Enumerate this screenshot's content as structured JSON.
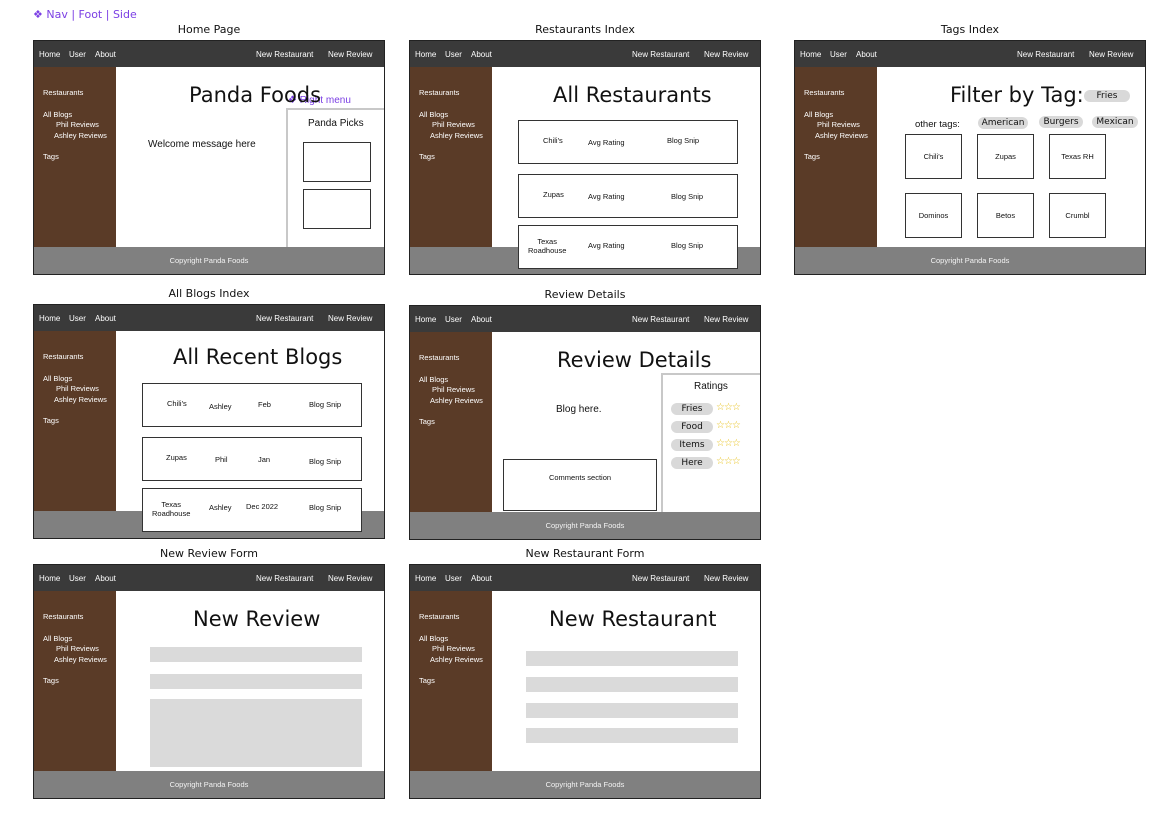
{
  "component_label": "❖ Nav | Foot | Side",
  "nav": {
    "home": "Home",
    "user": "User",
    "about": "About",
    "new_restaurant": "New Restaurant",
    "new_review": "New Review"
  },
  "side": {
    "restaurants": "Restaurants",
    "all_blogs": "All Blogs",
    "phil": "Phil Reviews",
    "ashley": "Ashley Reviews",
    "tags": "Tags"
  },
  "footer": "Copyright Panda Foods",
  "home": {
    "frame_title": "Home  Page",
    "heading": "Panda Foods",
    "welcome": "Welcome message here",
    "right_menu_label": "❖ Right menu",
    "picks": "Panda Picks"
  },
  "restaurants_index": {
    "frame_title": "Restaurants Index",
    "heading": "All Restaurants",
    "rows": [
      {
        "name": "Chili's",
        "rating": "Avg Rating",
        "snip": "Blog Snip"
      },
      {
        "name": "Zupas",
        "rating": "Avg Rating",
        "snip": "Blog Snip"
      },
      {
        "name": "Texas\nRoadhouse",
        "rating": "Avg Rating",
        "snip": "Blog Snip"
      }
    ]
  },
  "tags_index": {
    "frame_title": "Tags Index",
    "heading": "Filter by Tag:",
    "active_tag": "Fries",
    "other_label": "other tags:",
    "other_tags": [
      "American",
      "Burgers",
      "Mexican"
    ],
    "cards": [
      "Chili's",
      "Zupas",
      "Texas RH",
      "Dominos",
      "Betos",
      "Crumbl"
    ]
  },
  "blogs_index": {
    "frame_title": "All Blogs Index",
    "heading": "All Recent Blogs",
    "rows": [
      {
        "name": "Chili's",
        "author": "Ashley",
        "date": "Feb",
        "snip": "Blog Snip"
      },
      {
        "name": "Zupas",
        "author": "Phil",
        "date": "Jan",
        "snip": "Blog Snip"
      },
      {
        "name": "Texas\nRoadhouse",
        "author": "Ashley",
        "date": "Dec 2022",
        "snip": "Blog Snip"
      }
    ]
  },
  "review_details": {
    "frame_title": "Review Details",
    "heading": "Review Details",
    "blog": "Blog here.",
    "comments": "Comments section",
    "ratings_title": "Ratings",
    "ratings": [
      {
        "label": "Fries",
        "stars": "☆☆☆"
      },
      {
        "label": "Food",
        "stars": "☆☆☆"
      },
      {
        "label": "Items",
        "stars": "☆☆☆"
      },
      {
        "label": "Here",
        "stars": "☆☆☆"
      }
    ]
  },
  "new_review": {
    "frame_title": "New Review Form",
    "heading": "New Review"
  },
  "new_restaurant": {
    "frame_title": "New Restaurant Form",
    "heading": "New Restaurant"
  },
  "colors": {
    "nav": "#3a3a3a",
    "sidebar": "#5a3b27",
    "footer": "#808080",
    "accent": "#7b3fe4"
  }
}
